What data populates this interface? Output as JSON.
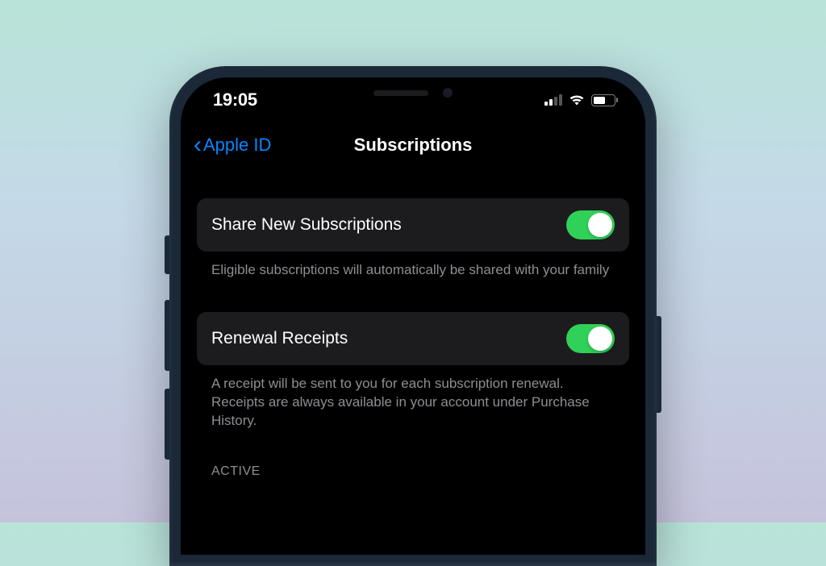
{
  "status": {
    "time": "19:05"
  },
  "nav": {
    "back_label": "Apple ID",
    "title": "Subscriptions"
  },
  "settings": {
    "share": {
      "label": "Share New Subscriptions",
      "footer": "Eligible subscriptions will automatically be shared with your family",
      "enabled": true
    },
    "receipts": {
      "label": "Renewal Receipts",
      "footer": "A receipt will be sent to you for each subscription renewal. Receipts are always available in your account under Purchase History.",
      "enabled": true
    }
  },
  "sections": {
    "active_header": "ACTIVE"
  },
  "colors": {
    "accent": "#0a84ff",
    "toggle_on": "#30d158",
    "cell_bg": "#1c1c1e",
    "footer_text": "#8e8e93"
  }
}
